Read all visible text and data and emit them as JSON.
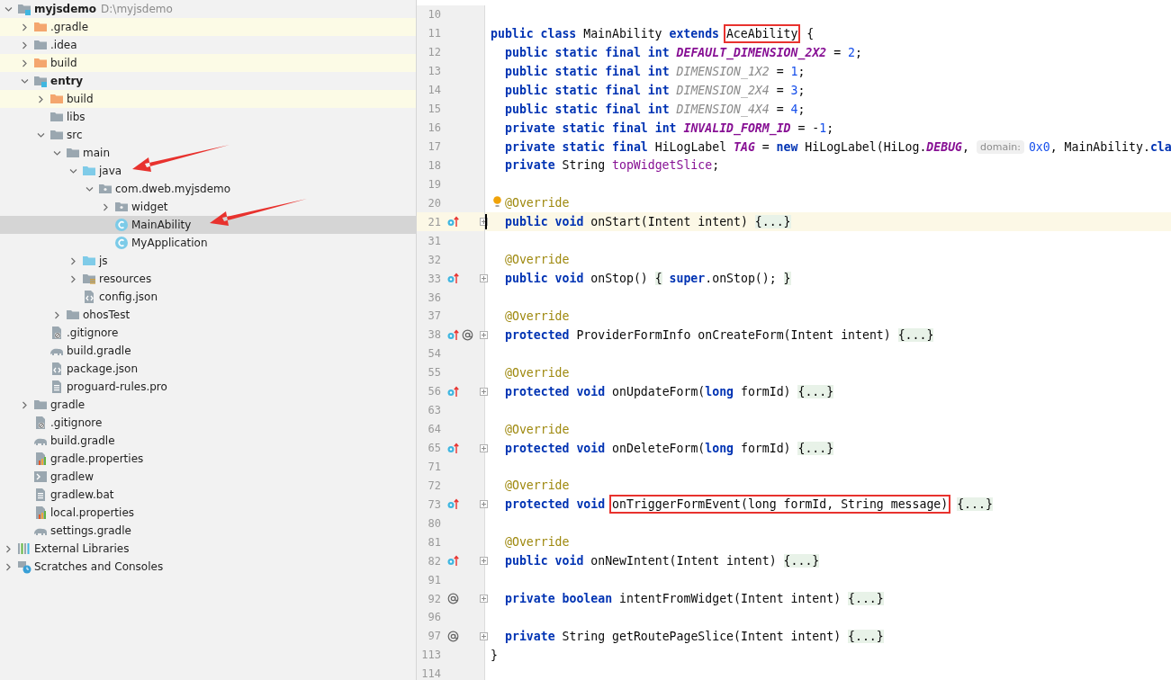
{
  "project_tree": {
    "items": [
      {
        "label": "myjsdemo",
        "path": "D:\\myjsdemo",
        "kind": "module",
        "bold": true,
        "expanded": true,
        "children": [
          {
            "label": ".gradle",
            "kind": "excluded-folder",
            "excluded": true,
            "expanded": false
          },
          {
            "label": ".idea",
            "kind": "folder",
            "expanded": false
          },
          {
            "label": "build",
            "kind": "excluded-folder",
            "excluded": true,
            "expanded": false
          },
          {
            "label": "entry",
            "kind": "module",
            "bold": true,
            "expanded": true,
            "children": [
              {
                "label": "build",
                "kind": "excluded-folder",
                "excluded": true,
                "expanded": false
              },
              {
                "label": "libs",
                "kind": "folder"
              },
              {
                "label": "src",
                "kind": "folder",
                "expanded": true,
                "children": [
                  {
                    "label": "main",
                    "kind": "folder",
                    "expanded": true,
                    "children": [
                      {
                        "label": "java",
                        "kind": "source-folder",
                        "expanded": true,
                        "annotated": true,
                        "children": [
                          {
                            "label": "com.dweb.myjsdemo",
                            "kind": "package",
                            "expanded": true,
                            "children": [
                              {
                                "label": "widget",
                                "kind": "package",
                                "expanded": false
                              },
                              {
                                "label": "MainAbility",
                                "kind": "class",
                                "selected": true,
                                "annotated": true
                              },
                              {
                                "label": "MyApplication",
                                "kind": "class",
                                "selected": false
                              }
                            ]
                          }
                        ]
                      },
                      {
                        "label": "js",
                        "kind": "source-folder",
                        "expanded": false
                      },
                      {
                        "label": "resources",
                        "kind": "resources-folder",
                        "expanded": false
                      },
                      {
                        "label": "config.json",
                        "kind": "json-file"
                      }
                    ]
                  },
                  {
                    "label": "ohosTest",
                    "kind": "folder",
                    "expanded": false
                  }
                ]
              },
              {
                "label": ".gitignore",
                "kind": "ignore-file"
              },
              {
                "label": "build.gradle",
                "kind": "gradle-file"
              },
              {
                "label": "package.json",
                "kind": "json-file"
              },
              {
                "label": "proguard-rules.pro",
                "kind": "text-file"
              }
            ]
          },
          {
            "label": "gradle",
            "kind": "folder",
            "expanded": false
          },
          {
            "label": ".gitignore",
            "kind": "ignore-file"
          },
          {
            "label": "build.gradle",
            "kind": "gradle-file"
          },
          {
            "label": "gradle.properties",
            "kind": "properties-file"
          },
          {
            "label": "gradlew",
            "kind": "shell-file"
          },
          {
            "label": "gradlew.bat",
            "kind": "text-file"
          },
          {
            "label": "local.properties",
            "kind": "properties-file"
          },
          {
            "label": "settings.gradle",
            "kind": "gradle-file"
          }
        ]
      },
      {
        "label": "External Libraries",
        "kind": "libraries",
        "expanded": false
      },
      {
        "label": "Scratches and Consoles",
        "kind": "scratches",
        "expanded": false
      }
    ]
  },
  "editor": {
    "lines": [
      {
        "number": "10"
      },
      {
        "number": "11",
        "tokens": [
          {
            "text": "public class",
            "kind": "keyword"
          },
          {
            "text": "MainAbility",
            "kind": "plain"
          },
          {
            "text": "extends",
            "kind": "keyword"
          },
          {
            "text": "AceAbility",
            "kind": "plain",
            "boxed": true
          },
          {
            "text": "{",
            "kind": "plain"
          }
        ]
      },
      {
        "number": "12",
        "indent": true,
        "tokens": [
          {
            "text": "public static final int",
            "kind": "keyword"
          },
          {
            "text": "DEFAULT_DIMENSION_2X2",
            "kind": "constant"
          },
          {
            "text": "=",
            "kind": "plain"
          },
          {
            "text": "2",
            "kind": "number"
          },
          {
            "text": ";",
            "kind": "plain",
            "join": true
          }
        ]
      },
      {
        "number": "13",
        "indent": true,
        "tokens": [
          {
            "text": "public static final int",
            "kind": "keyword"
          },
          {
            "text": "DIMENSION_1X2",
            "kind": "unused-constant"
          },
          {
            "text": "=",
            "kind": "plain"
          },
          {
            "text": "1",
            "kind": "number"
          },
          {
            "text": ";",
            "kind": "plain",
            "join": true
          }
        ]
      },
      {
        "number": "14",
        "indent": true,
        "tokens": [
          {
            "text": "public static final int",
            "kind": "keyword"
          },
          {
            "text": "DIMENSION_2X4",
            "kind": "unused-constant"
          },
          {
            "text": "=",
            "kind": "plain"
          },
          {
            "text": "3",
            "kind": "number"
          },
          {
            "text": ";",
            "kind": "plain",
            "join": true
          }
        ]
      },
      {
        "number": "15",
        "indent": true,
        "tokens": [
          {
            "text": "public static final int",
            "kind": "keyword"
          },
          {
            "text": "DIMENSION_4X4",
            "kind": "unused-constant"
          },
          {
            "text": "=",
            "kind": "plain"
          },
          {
            "text": "4",
            "kind": "number"
          },
          {
            "text": ";",
            "kind": "plain",
            "join": true
          }
        ]
      },
      {
        "number": "16",
        "indent": true,
        "tokens": [
          {
            "text": "private static final int",
            "kind": "keyword"
          },
          {
            "text": "INVALID_FORM_ID",
            "kind": "constant"
          },
          {
            "text": "= -",
            "kind": "plain"
          },
          {
            "text": "1",
            "kind": "number",
            "join": true
          },
          {
            "text": ";",
            "kind": "plain",
            "join": true
          }
        ]
      },
      {
        "number": "17",
        "indent": true,
        "tokens": [
          {
            "text": "private static final",
            "kind": "keyword"
          },
          {
            "text": "HiLogLabel",
            "kind": "plain"
          },
          {
            "text": "TAG",
            "kind": "constant"
          },
          {
            "text": "=",
            "kind": "plain"
          },
          {
            "text": "new",
            "kind": "keyword"
          },
          {
            "text": "HiLogLabel(HiLog.",
            "kind": "plain"
          },
          {
            "text": "DEBUG",
            "kind": "constant",
            "join": true
          },
          {
            "text": ",",
            "kind": "plain",
            "join": true
          },
          {
            "text": "domain:",
            "kind": "hint"
          },
          {
            "text": "0x0",
            "kind": "number",
            "join": true
          },
          {
            "text": ", MainAbility.",
            "kind": "plain",
            "join": true
          },
          {
            "text": "cla",
            "kind": "keyword",
            "join": true
          }
        ]
      },
      {
        "number": "18",
        "indent": true,
        "tokens": [
          {
            "text": "private",
            "kind": "keyword"
          },
          {
            "text": "String",
            "kind": "plain"
          },
          {
            "text": "topWidgetSlice",
            "kind": "field"
          },
          {
            "text": ";",
            "kind": "plain",
            "join": true
          }
        ]
      },
      {
        "number": "19"
      },
      {
        "number": "20",
        "indent": true,
        "intention": true,
        "tokens": [
          {
            "text": "@Override",
            "kind": "annotation"
          }
        ]
      },
      {
        "number": "21",
        "indent": true,
        "current": true,
        "overrides": true,
        "foldable": true,
        "tokens": [
          {
            "text": "public void",
            "kind": "keyword"
          },
          {
            "text": "onStart(Intent intent)",
            "kind": "plain"
          },
          {
            "text": "{...}",
            "kind": "fold"
          }
        ]
      },
      {
        "number": "31"
      },
      {
        "number": "32",
        "indent": true,
        "tokens": [
          {
            "text": "@Override",
            "kind": "annotation"
          }
        ]
      },
      {
        "number": "33",
        "indent": true,
        "overrides": true,
        "foldable": true,
        "tokens": [
          {
            "text": "public void",
            "kind": "keyword"
          },
          {
            "text": "onStop()",
            "kind": "plain"
          },
          {
            "text": "{",
            "kind": "fold"
          },
          {
            "text": "super",
            "kind": "keyword"
          },
          {
            "text": ".onStop();",
            "kind": "plain",
            "join": true
          },
          {
            "text": "}",
            "kind": "fold"
          }
        ]
      },
      {
        "number": "36"
      },
      {
        "number": "37",
        "indent": true,
        "tokens": [
          {
            "text": "@Override",
            "kind": "annotation"
          }
        ]
      },
      {
        "number": "38",
        "indent": true,
        "overrides": true,
        "annotated": true,
        "foldable": true,
        "tokens": [
          {
            "text": "protected",
            "kind": "keyword"
          },
          {
            "text": "ProviderFormInfo onCreateForm(Intent intent)",
            "kind": "plain"
          },
          {
            "text": "{...}",
            "kind": "fold"
          }
        ]
      },
      {
        "number": "54"
      },
      {
        "number": "55",
        "indent": true,
        "tokens": [
          {
            "text": "@Override",
            "kind": "annotation"
          }
        ]
      },
      {
        "number": "56",
        "indent": true,
        "overrides": true,
        "foldable": true,
        "tokens": [
          {
            "text": "protected void",
            "kind": "keyword"
          },
          {
            "text": "onUpdateForm(",
            "kind": "plain"
          },
          {
            "text": "long",
            "kind": "keyword",
            "join": true
          },
          {
            "text": "formId)",
            "kind": "plain"
          },
          {
            "text": "{...}",
            "kind": "fold"
          }
        ]
      },
      {
        "number": "63"
      },
      {
        "number": "64",
        "indent": true,
        "tokens": [
          {
            "text": "@Override",
            "kind": "annotation"
          }
        ]
      },
      {
        "number": "65",
        "indent": true,
        "overrides": true,
        "foldable": true,
        "tokens": [
          {
            "text": "protected void",
            "kind": "keyword"
          },
          {
            "text": "onDeleteForm(",
            "kind": "plain"
          },
          {
            "text": "long",
            "kind": "keyword",
            "join": true
          },
          {
            "text": "formId)",
            "kind": "plain"
          },
          {
            "text": "{...}",
            "kind": "fold"
          }
        ]
      },
      {
        "number": "71"
      },
      {
        "number": "72",
        "indent": true,
        "tokens": [
          {
            "text": "@Override",
            "kind": "annotation"
          }
        ]
      },
      {
        "number": "73",
        "indent": true,
        "overrides": true,
        "foldable": true,
        "tokens": [
          {
            "text": "protected void",
            "kind": "keyword"
          },
          {
            "text": "onTriggerFormEvent(long formId, String message)",
            "kind": "plain",
            "boxed": true
          },
          {
            "text": "{...}",
            "kind": "fold"
          }
        ]
      },
      {
        "number": "80"
      },
      {
        "number": "81",
        "indent": true,
        "tokens": [
          {
            "text": "@Override",
            "kind": "annotation"
          }
        ]
      },
      {
        "number": "82",
        "indent": true,
        "overrides": true,
        "foldable": true,
        "tokens": [
          {
            "text": "public void",
            "kind": "keyword"
          },
          {
            "text": "onNewIntent(Intent intent)",
            "kind": "plain"
          },
          {
            "text": "{...}",
            "kind": "fold"
          }
        ]
      },
      {
        "number": "91"
      },
      {
        "number": "92",
        "indent": true,
        "annotated": true,
        "foldable": true,
        "tokens": [
          {
            "text": "private boolean",
            "kind": "keyword"
          },
          {
            "text": "intentFromWidget(Intent intent)",
            "kind": "plain"
          },
          {
            "text": "{...}",
            "kind": "fold"
          }
        ]
      },
      {
        "number": "96"
      },
      {
        "number": "97",
        "indent": true,
        "annotated": true,
        "foldable": true,
        "tokens": [
          {
            "text": "private",
            "kind": "keyword"
          },
          {
            "text": "String getRoutePageSlice(Intent intent)",
            "kind": "plain"
          },
          {
            "text": "{...}",
            "kind": "fold"
          }
        ]
      },
      {
        "number": "113",
        "tokens": [
          {
            "text": "}",
            "kind": "plain"
          }
        ]
      },
      {
        "number": "114"
      }
    ]
  }
}
